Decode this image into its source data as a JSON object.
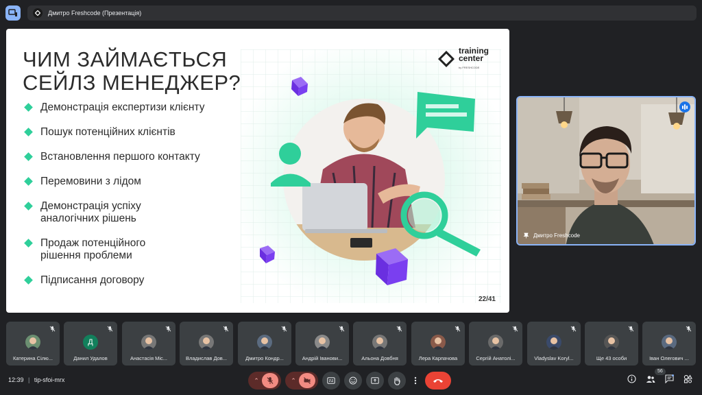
{
  "topbar": {
    "presenter_title": "Дмитро Freshcode (Презентація)"
  },
  "slide": {
    "heading_line1": "ЧИМ ЗАЙМАЄТЬСЯ",
    "heading_line2": "СЕЙЛЗ МЕНЕДЖЕР?",
    "bullets": [
      "Демонстрація експертизи клієнту",
      "Пошук потенційних клієнтів",
      "Встановлення першого контакту",
      "Перемовини з лідом",
      "Демонстрація успіху аналогічних рішень",
      "Продаж потенційного рішення проблеми",
      "Підписання договору"
    ],
    "logo_line1": "training",
    "logo_line2": "center",
    "logo_sub": "by FRESHCODE",
    "page": "22/41",
    "accent": "#2fcf9a",
    "purple": "#7a3ff0"
  },
  "speaker": {
    "name": "Дмитро Freshcode"
  },
  "participants": [
    {
      "name": "Катерина Сілю...",
      "initial": "",
      "color": "#6b8f71"
    },
    {
      "name": "Данил Удалов",
      "initial": "Д",
      "color": "#12805c"
    },
    {
      "name": "Анастасія Міс...",
      "initial": "",
      "color": "#777"
    },
    {
      "name": "Владислав Дов...",
      "initial": "",
      "color": "#777"
    },
    {
      "name": "Дмитро Кондр...",
      "initial": "",
      "color": "#5b6b80"
    },
    {
      "name": "Андрій Іванови...",
      "initial": "",
      "color": "#8a8a8a"
    },
    {
      "name": "Альона Довбня",
      "initial": "",
      "color": "#777"
    },
    {
      "name": "Лера Карпачова",
      "initial": "",
      "color": "#8a5a4a"
    },
    {
      "name": "Сергій Анатолі...",
      "initial": "",
      "color": "#6a6a6a"
    },
    {
      "name": "Vladyslav Koryl...",
      "initial": "",
      "color": "#3a4a6a"
    },
    {
      "name": "Ще 43 особи",
      "initial": "",
      "color": "#555"
    },
    {
      "name": "Іван Олегович ...",
      "initial": "",
      "color": "#5a6a80"
    }
  ],
  "bottombar": {
    "time": "12:39",
    "separator": "|",
    "meeting_code": "tip-sfoi-mrx",
    "participant_count": "56"
  }
}
